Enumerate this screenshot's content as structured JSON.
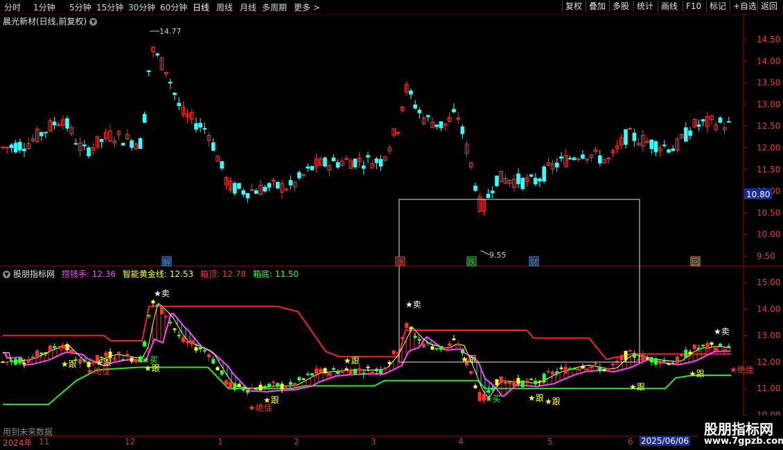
{
  "toolbar": {
    "periods": [
      "分时",
      "1分钟",
      "5分钟",
      "15分钟",
      "30分钟",
      "60分钟",
      "日线",
      "周线",
      "月线",
      "多周期",
      "更多 >"
    ],
    "active": "日线",
    "right": [
      "复权",
      "叠加",
      "多股",
      "统计",
      "画线",
      "F10",
      "标记",
      "+自选",
      "返回"
    ]
  },
  "stock": {
    "title": "晨光新材(日线,前复权)"
  },
  "main": {
    "high_label": "14.77",
    "low_label": "9.55",
    "price_tag": "10.80",
    "yaxis": [
      "14.50",
      "14.00",
      "13.50",
      "13.00",
      "12.50",
      "12.00",
      "11.50",
      "11.00",
      "10.50",
      "10.00",
      "9.50"
    ],
    "markers": [
      {
        "text": "解",
        "color": "#3399ff"
      },
      {
        "text": "涨",
        "color": "#ff3333"
      },
      {
        "text": "跌",
        "color": "#33cc33"
      },
      {
        "text": "财",
        "color": "#3399ff"
      },
      {
        "text": "回",
        "color": "#ff9933"
      }
    ]
  },
  "indicator": {
    "name": "股朋指标网",
    "items": [
      {
        "label": "捞钱手: 12.36",
        "color": "#ff44ff"
      },
      {
        "label": "智能黄金线: 12.53",
        "color": "#ffff33"
      },
      {
        "label": "箱顶: 12.78",
        "color": "#ff3333"
      },
      {
        "label": "箱底: 11.50",
        "color": "#33ff33"
      }
    ],
    "yaxis": [
      "15.00",
      "14.00",
      "13.00",
      "12.00",
      "11.00",
      "10.00"
    ],
    "signals": [
      {
        "text": "★卖",
        "color": "#ffffff"
      },
      {
        "text": "★卖",
        "color": "#ffffff"
      },
      {
        "text": "★卖",
        "color": "#ffffff"
      },
      {
        "text": "★跟",
        "color": "#ffff33"
      },
      {
        "text": "★跟",
        "color": "#ffff33"
      },
      {
        "text": "★跟",
        "color": "#ffff33"
      },
      {
        "text": "★跟",
        "color": "#ffff33"
      },
      {
        "text": "★跟",
        "color": "#ffff33"
      },
      {
        "text": "★跟",
        "color": "#ffff33"
      },
      {
        "text": "★跟",
        "color": "#ffff33"
      },
      {
        "text": "★跟",
        "color": "#ffff33"
      },
      {
        "text": "★跟",
        "color": "#ffff33"
      },
      {
        "text": "★跟",
        "color": "#ffff33"
      },
      {
        "text": "★绝佳",
        "color": "#ff3333"
      },
      {
        "text": "★绝佳",
        "color": "#ff3333"
      },
      {
        "text": "★绝佳",
        "color": "#ff3333"
      },
      {
        "text": "★买",
        "color": "#33ff33"
      },
      {
        "text": "★买",
        "color": "#33ff33"
      }
    ]
  },
  "footer": {
    "future_text": "用到未来数据",
    "year": "2024年",
    "months": [
      "11",
      "12",
      "1",
      "2",
      "3",
      "4",
      "5",
      "6"
    ],
    "date_tag": "2025/06/06",
    "watermark": "股朋指标网",
    "watermark_url": "www.7gpzb.com"
  },
  "colors": {
    "up": "#ff3333",
    "down": "#33ffff",
    "axis": "#aa0000",
    "box_top": "#ff2020",
    "box_bottom": "#22ee22"
  }
}
